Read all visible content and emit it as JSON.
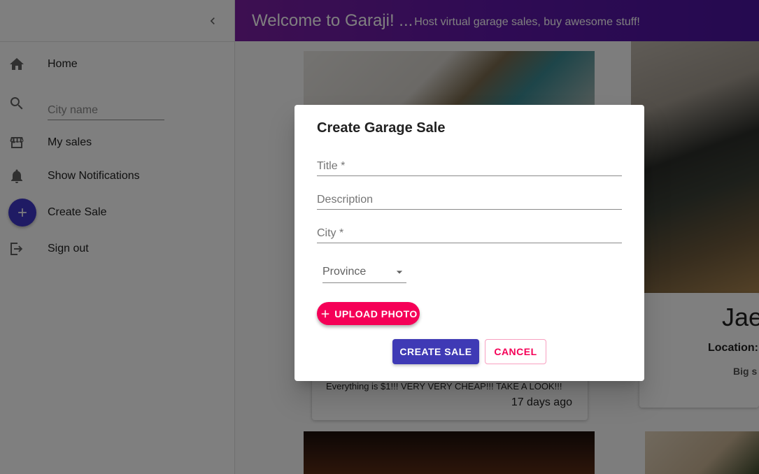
{
  "appbar": {
    "title": "Welcome to Garaji! ...",
    "subtitle": "Host virtual garage sales, buy awesome stuff!"
  },
  "drawer": {
    "collapse_icon": "chevron-left-icon",
    "items": [
      {
        "label": "Home",
        "icon": "home-icon"
      },
      {
        "label": "",
        "icon": "search-icon"
      },
      {
        "label": "My sales",
        "icon": "store-icon"
      },
      {
        "label": "Show Notifications",
        "icon": "bell-icon"
      },
      {
        "label": "Create Sale",
        "icon": "add-icon"
      },
      {
        "label": "Sign out",
        "icon": "sign-out-icon"
      }
    ],
    "search": {
      "placeholder": "City name",
      "value": ""
    }
  },
  "cards": {
    "card3": {
      "description": "Everything is $1!!! VERY VERY CHEAP!!! TAKE A LOOK!!!",
      "date": "17 days ago"
    },
    "card4": {
      "name": "Jae",
      "location_label": "Location:",
      "description": "Big s"
    }
  },
  "dialog": {
    "title": "Create Garage Sale",
    "fields": {
      "title": {
        "placeholder": "Title *",
        "value": ""
      },
      "description": {
        "placeholder": "Description",
        "value": ""
      },
      "city": {
        "placeholder": "City *",
        "value": ""
      }
    },
    "province": {
      "label": "Province"
    },
    "upload_label": "UPLOAD PHOTO",
    "create_label": "CREATE SALE",
    "cancel_label": "CANCEL"
  },
  "colors": {
    "primary": "#3f3ab5",
    "secondary": "#f50057",
    "appbar_start": "#7b1fa2",
    "appbar_end": "#4a14a0"
  }
}
